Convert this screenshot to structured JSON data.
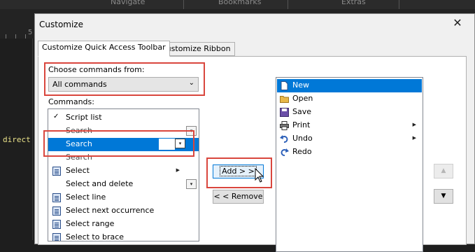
{
  "background": {
    "tabs": [
      "Navigate",
      "Bookmarks",
      "Extras"
    ],
    "ruler_number": "5",
    "code_fragment": "direct"
  },
  "dialog": {
    "title": "Customize",
    "tabs": [
      {
        "label": "Customize Quick Access Toolbar",
        "active": true
      },
      {
        "label": "Customize Ribbon",
        "active": false
      }
    ],
    "choose_label": "Choose commands from:",
    "choose_value": "All commands",
    "commands_label": "Commands:",
    "commands": [
      {
        "label": "Script list",
        "icon": "check-icon"
      },
      {
        "label": "Search",
        "icon": "none",
        "ghost": true
      },
      {
        "label": "Search",
        "icon": "none",
        "selected": true
      },
      {
        "label": "Search",
        "icon": "none",
        "ghost": true
      },
      {
        "label": "Select",
        "icon": "document-icon"
      },
      {
        "label": "Select and delete",
        "icon": "none"
      },
      {
        "label": "Select line",
        "icon": "document-icon"
      },
      {
        "label": "Select next occurrence",
        "icon": "document-icon"
      },
      {
        "label": "Select range",
        "icon": "document-icon"
      },
      {
        "label": "Select to brace",
        "icon": "document-icon"
      }
    ],
    "add_button": "Add > >",
    "remove_button": "< < Remove",
    "toolbar_items": [
      {
        "label": "New",
        "icon": "new-document-icon",
        "selected": true
      },
      {
        "label": "Open",
        "icon": "folder-icon"
      },
      {
        "label": "Save",
        "icon": "save-icon"
      },
      {
        "label": "Print",
        "icon": "printer-icon"
      },
      {
        "label": "Undo",
        "icon": "undo-icon"
      },
      {
        "label": "Redo",
        "icon": "redo-icon"
      }
    ],
    "move_up": "▲",
    "move_down": "▼",
    "highlight_color": "#d9463d",
    "selection_color": "#0078d7"
  }
}
